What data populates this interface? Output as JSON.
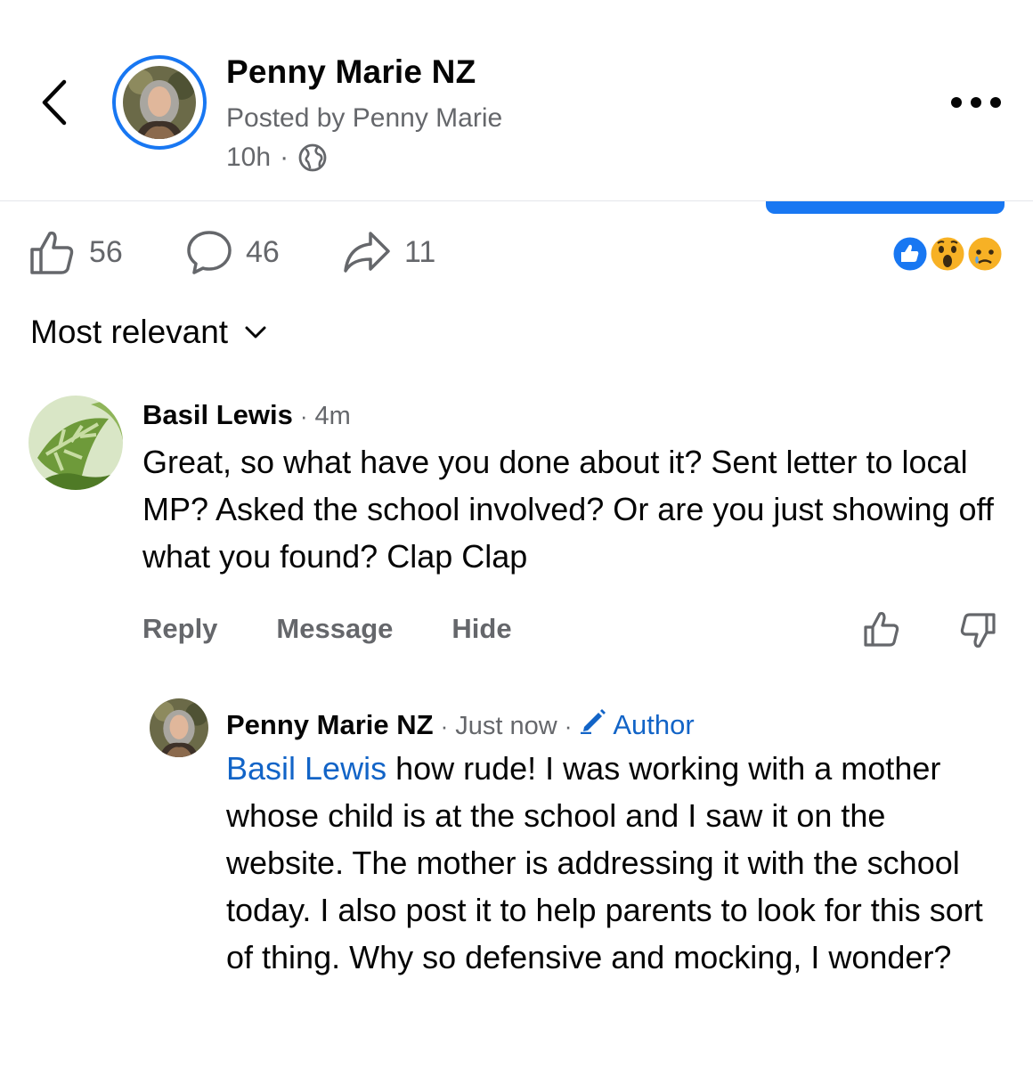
{
  "header": {
    "page_name": "Penny Marie NZ",
    "posted_by": "Posted by Penny Marie",
    "time": "10h",
    "separator": "·"
  },
  "stats": {
    "likes": "56",
    "comments": "46",
    "shares": "11"
  },
  "sort": {
    "label": "Most relevant"
  },
  "comments": [
    {
      "name": "Basil Lewis",
      "time": "4m",
      "text": "Great, so what have you done about it? Sent letter to local MP? Asked the school involved? Or are you just showing off what you found? Clap Clap",
      "actions": {
        "reply": "Reply",
        "message": "Message",
        "hide": "Hide"
      }
    },
    {
      "name": "Penny Marie NZ",
      "time": "Just now",
      "badge": "Author",
      "mention": "Basil Lewis",
      "text": " how rude! I was working with a mother whose child is at the school and I saw it on the website. The mother is addressing it with the school today. I also post it to help parents to look for this sort of thing. Why so defensive and mocking, I wonder?"
    }
  ],
  "colors": {
    "accent": "#1877f2",
    "mention": "#1264c7",
    "secondary_text": "#65676b"
  }
}
